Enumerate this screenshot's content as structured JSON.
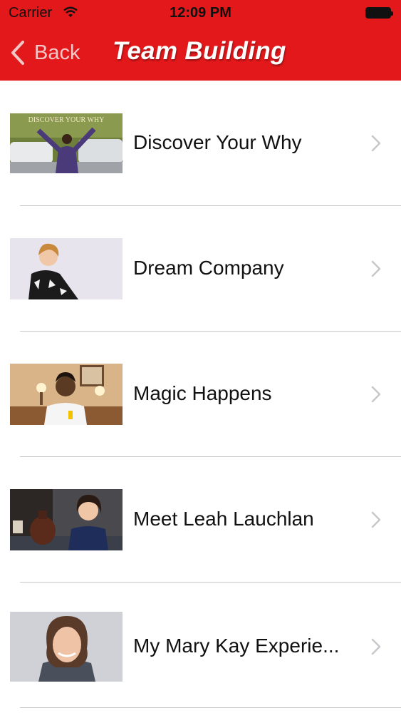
{
  "status_bar": {
    "carrier": "Carrier",
    "time": "12:09 PM"
  },
  "nav": {
    "back_label": "Back",
    "title": "Team Building"
  },
  "videos": [
    {
      "label": "Discover Your Why",
      "thumb_caption": "DISCOVER YOUR WHY"
    },
    {
      "label": "Dream Company"
    },
    {
      "label": "Magic Happens"
    },
    {
      "label": "Meet Leah Lauchlan"
    },
    {
      "label": "My Mary Kay Experie..."
    }
  ],
  "colors": {
    "nav_bar": "#e2181b",
    "separator": "#c8c7cc",
    "chevron": "#c7c7cc"
  }
}
